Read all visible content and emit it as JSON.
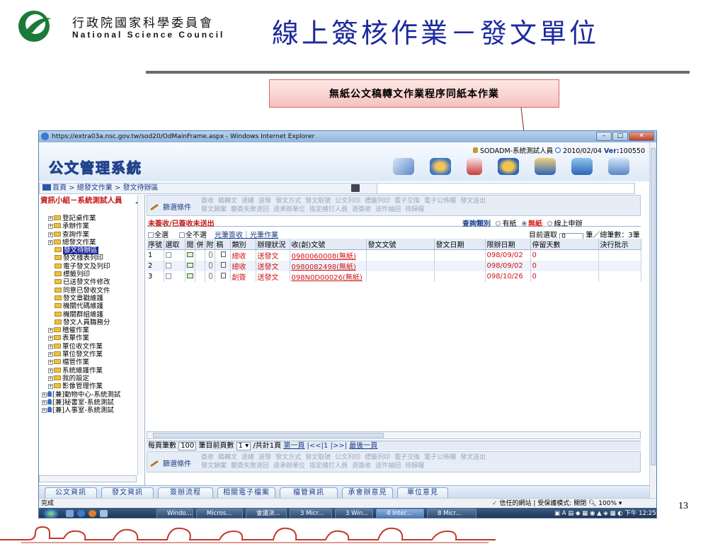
{
  "slide": {
    "org_name_zh": "行政院國家科學委員會",
    "org_name_en": "National Science Council",
    "title": "線上簽核作業－發文單位",
    "callout": "無紙公文稿轉文作業程序同紙本作業",
    "page_number": "13"
  },
  "browser": {
    "window_title": "https://extra03a.nsc.gov.tw/sod20/OdMainFrame.aspx - Windows Internet Explorer",
    "app_title": "公文管理系統",
    "user_info": "SODADM-系統測試人員",
    "date": "2010/02/04",
    "version_label": "Ver:",
    "version": "100550",
    "breadcrumb": "首頁 > 總發文作業 > 發文待辦區",
    "unit_name": "資訊小組－系統測試人員",
    "collapse_symbol": "◂"
  },
  "tree": [
    {
      "label": "登記桌作業",
      "indent": 1,
      "type": "folder"
    },
    {
      "label": "承辦作業",
      "indent": 1,
      "type": "folder"
    },
    {
      "label": "查詢作業",
      "indent": 1,
      "type": "folder"
    },
    {
      "label": "總發文作業",
      "indent": 1,
      "type": "folder"
    },
    {
      "label": "發文待辦區",
      "indent": 2,
      "type": "leaf",
      "selected": true
    },
    {
      "label": "發文様表列印",
      "indent": 2,
      "type": "leaf"
    },
    {
      "label": "電子發文及列印",
      "indent": 2,
      "type": "leaf"
    },
    {
      "label": "標籤列印",
      "indent": 2,
      "type": "leaf"
    },
    {
      "label": "已送發文件修改",
      "indent": 2,
      "type": "leaf"
    },
    {
      "label": "同意已發收文件",
      "indent": 2,
      "type": "leaf"
    },
    {
      "label": "發文章戳維護",
      "indent": 2,
      "type": "leaf"
    },
    {
      "label": "機關代碼維護",
      "indent": 2,
      "type": "leaf"
    },
    {
      "label": "機關群組維護",
      "indent": 2,
      "type": "leaf"
    },
    {
      "label": "發文人員職務分",
      "indent": 2,
      "type": "leaf"
    },
    {
      "label": "稽催作業",
      "indent": 1,
      "type": "folder"
    },
    {
      "label": "表單作業",
      "indent": 1,
      "type": "folder"
    },
    {
      "label": "單位收文作業",
      "indent": 1,
      "type": "folder"
    },
    {
      "label": "單位發文作業",
      "indent": 1,
      "type": "folder"
    },
    {
      "label": "檔管作業",
      "indent": 1,
      "type": "folder"
    },
    {
      "label": "系統維護作業",
      "indent": 1,
      "type": "folder"
    },
    {
      "label": "我的設定",
      "indent": 1,
      "type": "folder"
    },
    {
      "label": "影像管理作業",
      "indent": 1,
      "type": "folder"
    },
    {
      "label": "[兼]動物中心-系統測試",
      "indent": 0,
      "type": "pin"
    },
    {
      "label": "[兼]秘書室-系統測試",
      "indent": 0,
      "type": "pin"
    },
    {
      "label": "[兼]人事室-系統測試",
      "indent": 0,
      "type": "pin"
    }
  ],
  "filter": {
    "button": "篩選條件",
    "links_row1": [
      "簽收",
      "稿轉文",
      "退繕",
      "送發",
      "發文方式",
      "發文取號",
      "公文列印",
      "標籤列印",
      "電子交換",
      "電子公佈欄",
      "發文送出"
    ],
    "links_row2": [
      "發文銷案",
      "驗簽失敗退回",
      "退承辦單位",
      "指定繕打人員",
      "退簽收",
      "送件抽回",
      "待歸檔"
    ]
  },
  "status": {
    "text": "未簽收/已簽收未送出",
    "query_label": "查詢類別",
    "opt_paper": "有紙",
    "opt_nopaper": "無紙",
    "opt_online": "線上申辦"
  },
  "selection": {
    "select_all": "全選",
    "select_none": "全不選",
    "links": "光筆簽收｜光筆作業",
    "selected_label": "目前選取",
    "selected_count": "0",
    "total_text": "筆／總筆數：3筆"
  },
  "table": {
    "headers": [
      "序號",
      "選取",
      "閱",
      "併",
      "附",
      "稿",
      "類別",
      "辦理狀況",
      "收(創)文號",
      "發文文號",
      "發文日期",
      "限辦日期",
      "停留天數",
      "決行批示"
    ],
    "rows": [
      {
        "no": "1",
        "category": "總收",
        "state": "送發文",
        "doc_no": "0980060008(無紙)",
        "send_no": "",
        "send_date": "",
        "due": "098/09/02",
        "days": "0"
      },
      {
        "no": "2",
        "category": "總收",
        "state": "送發文",
        "doc_no": "0980082498(無紙)",
        "send_no": "",
        "send_date": "",
        "due": "098/09/02",
        "days": "0"
      },
      {
        "no": "3",
        "category": "創簽",
        "state": "送發文",
        "doc_no": "098N0D00026(無紙)",
        "send_no": "",
        "send_date": "",
        "due": "098/10/26",
        "days": "0"
      }
    ]
  },
  "pager": {
    "per_page_label": "每頁筆數",
    "per_page": "100",
    "unit_label": "筆目前頁數",
    "current_page": "1",
    "total_label": "/共計1頁",
    "first": "第一頁",
    "nav": "|<<|1 |>>|",
    "last": "最後一頁"
  },
  "tabs": [
    "公文資訊",
    "發文資訊",
    "簽辦流程",
    "相關電子檔案",
    "檔管資訊",
    "承會辦意見",
    "單位意見"
  ],
  "ie_status": {
    "left": "完成",
    "zone": "信任的網站 | 受保護模式: 關閉",
    "zoom": "100%"
  },
  "taskbar": {
    "tasks": [
      "Windo...",
      "Micros...",
      "會議決...",
      "3 Micr...",
      "3 Win...",
      "4 Inter...",
      "8 Micr..."
    ],
    "clock": "下午 12:25"
  }
}
